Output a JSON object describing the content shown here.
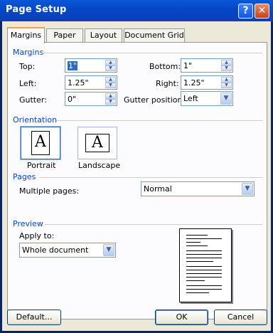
{
  "window": {
    "title": "Page Setup",
    "help": "?",
    "close": "✕"
  },
  "tabs": [
    "Margins",
    "Paper",
    "Layout",
    "Document Grid"
  ],
  "margins": {
    "section": "Margins",
    "top": {
      "label": "Top:",
      "value": "1\""
    },
    "bottom": {
      "label": "Bottom:",
      "value": "1\""
    },
    "left": {
      "label": "Left:",
      "value": "1.25\""
    },
    "right": {
      "label": "Right:",
      "value": "1.25\""
    },
    "gutter": {
      "label": "Gutter:",
      "value": "0\""
    },
    "gutter_position": {
      "label": "Gutter position:",
      "value": "Left"
    }
  },
  "orientation": {
    "section": "Orientation",
    "portrait": "Portrait",
    "landscape": "Landscape",
    "icon_glyph": "A",
    "selected": "Portrait"
  },
  "pages": {
    "section": "Pages",
    "multiple_label": "Multiple pages:",
    "multiple_value": "Normal"
  },
  "preview": {
    "section": "Preview",
    "apply_label": "Apply to:",
    "apply_value": "Whole document"
  },
  "buttons": {
    "default": "Default...",
    "ok": "OK",
    "cancel": "Cancel"
  }
}
